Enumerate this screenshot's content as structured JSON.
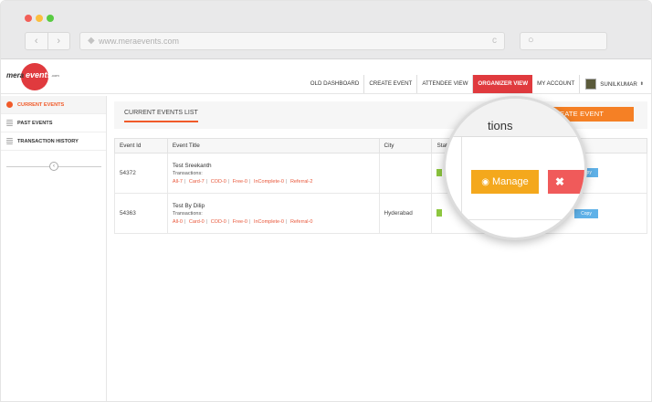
{
  "browser": {
    "url": "www.meraevents.com",
    "nav_back": "‹",
    "nav_forward": "›",
    "home_icon": "◆",
    "reload_icon": "c",
    "search_icon": "○"
  },
  "logo": {
    "part1": "mera",
    "part2": "events",
    "part3": ".com"
  },
  "topnav": {
    "items": [
      "OLD DASHBOARD",
      "CREATE EVENT",
      "ATTENDEE VIEW",
      "ORGANIZER VIEW",
      "MY ACCOUNT"
    ],
    "active": "ORGANIZER VIEW",
    "user_name": "SUNILKUMAR",
    "user_caret": "⬍"
  },
  "sidebar": {
    "items": [
      {
        "label": "CURRENT EVENTS",
        "active": true
      },
      {
        "label": "PAST EVENTS",
        "active": false
      },
      {
        "label": "TRANSACTION HISTORY",
        "active": false
      }
    ],
    "collapse_icon": "‹"
  },
  "main": {
    "title": "CURRENT EVENTS LIST",
    "create_button": "CREATE EVENT",
    "columns": [
      "Event Id",
      "Event Title",
      "City",
      "Status"
    ],
    "rows": [
      {
        "id": "54372",
        "title": "Test Sreekanth",
        "sub": "Transactions:",
        "links": [
          "All-7",
          "Card-7",
          "COD-0",
          "Free-0",
          "InComplete-0",
          "Referral-2"
        ],
        "city": "",
        "copy_label": "Copy"
      },
      {
        "id": "54363",
        "title": "Test By Dilip",
        "sub": "Transactions:",
        "links": [
          "All-0",
          "Card-0",
          "COD-0",
          "Free-0",
          "InComplete-0",
          "Referral-0"
        ],
        "city": "Hyderabad",
        "copy_label": "Copy"
      }
    ]
  },
  "magnifier": {
    "header_text": "tions",
    "manage_label": "Manage",
    "manage_icon": "◉",
    "delete_icon": "✖"
  },
  "colors": {
    "accent": "#e03a3e",
    "orange": "#f58025",
    "manage": "#f4a81c",
    "delete": "#f05a5a",
    "copy": "#5fb1e8",
    "status_active": "#8dc63f"
  }
}
